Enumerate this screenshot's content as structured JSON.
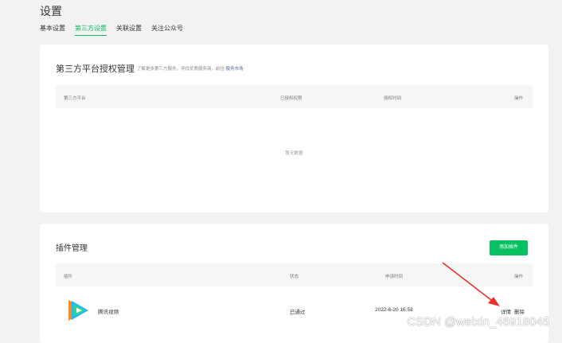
{
  "page": {
    "title": "设置"
  },
  "tabs": [
    {
      "label": "基本设置",
      "active": false
    },
    {
      "label": "第三方设置",
      "active": true
    },
    {
      "label": "关联设置",
      "active": false
    },
    {
      "label": "关注公众号",
      "active": false
    }
  ],
  "third_party": {
    "title": "第三方平台授权管理",
    "desc": "了解更多第三方服务，寻找优质服务商，前往",
    "desc_link": "服务市场",
    "columns": [
      "第三方平台",
      "已授权权限",
      "授权时间",
      "操作"
    ],
    "empty_text": "暂无数据"
  },
  "plugins": {
    "title": "插件管理",
    "add_button": "添加插件",
    "columns": [
      "插件",
      "状态",
      "申请时间",
      "操作"
    ],
    "rows": [
      {
        "name": "腾讯视频",
        "status": "已通过",
        "apply_time": "2022-6-20 16:58",
        "action_detail": "详情",
        "action_delete": "删除"
      }
    ]
  },
  "annotation": {
    "arrow_color": "#e8322b"
  },
  "watermark": "CSDN @weixin_46918045",
  "colors": {
    "accent": "#07c160",
    "link": "#576b95"
  }
}
